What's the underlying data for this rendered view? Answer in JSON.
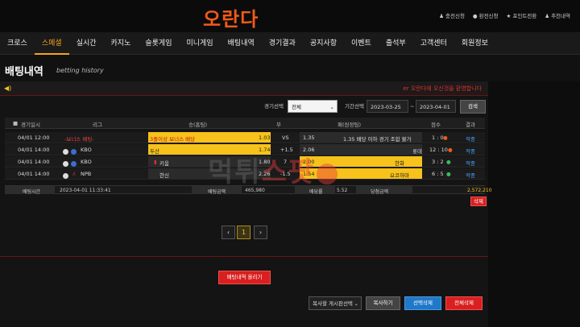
{
  "brand": {
    "logo_text": "오란다"
  },
  "top_links": [
    {
      "icon": "person-plus-icon",
      "label": "충전신청"
    },
    {
      "icon": "coin-icon",
      "label": "환전신청"
    },
    {
      "icon": "star-icon",
      "label": "포인트전환"
    },
    {
      "icon": "users-icon",
      "label": "추천내역"
    }
  ],
  "nav": [
    {
      "label": "크로스"
    },
    {
      "label": "스페셜"
    },
    {
      "label": "실시간"
    },
    {
      "label": "카지노"
    },
    {
      "label": "슬롯게임"
    },
    {
      "label": "미니게임"
    },
    {
      "label": "배팅내역"
    },
    {
      "label": "경기결과"
    },
    {
      "label": "공지사항"
    },
    {
      "label": "이벤트"
    },
    {
      "label": "출석부"
    },
    {
      "label": "고객센터"
    },
    {
      "label": "회원정보"
    }
  ],
  "page": {
    "title": "배팅내역",
    "subtitle": "betting history"
  },
  "notice": {
    "text": "오란다에 오신것을 환영합니다",
    "prefix": "er"
  },
  "filter": {
    "game_label": "경기선택",
    "game_value": "전체",
    "period_label": "기간선택",
    "date_from": "2023-03-25",
    "date_sep": "~",
    "date_to": "2023-04-01",
    "search_button": "검색"
  },
  "table": {
    "headers": [
      "경기일시",
      "리그",
      "승(홈팀)",
      "무",
      "패(원정팀)",
      "점수",
      "결과"
    ],
    "rows": [
      {
        "time": "04/01 12:00",
        "league": "-보너스 배팅-",
        "home": "3폴이상 보너스 배당",
        "home_odds": "1.03",
        "draw": "VS",
        "away_odds": "1.35",
        "away": "1.35 배당 이하 경기 조합 불가",
        "score": "1 : 0",
        "result": "적중"
      },
      {
        "time": "04/01 14:00",
        "league": "KBO",
        "home": "두산",
        "home_odds": "1.74",
        "draw": "+1.5",
        "away_odds": "2.06",
        "away": "롯데",
        "score": "12 : 10",
        "result": "적중"
      },
      {
        "time": "04/01 14:00",
        "league": "KBO",
        "home": "키움",
        "home_odds": "1.80",
        "draw": "7",
        "away_odds": "2.00",
        "away": "한화",
        "score": "3 : 2",
        "result": "적중"
      },
      {
        "time": "04/01 14:00",
        "league": "NPB",
        "home": "한신",
        "home_odds": "2.26",
        "draw": "-1.5",
        "away_odds": "1.54",
        "away": "요코하마",
        "score": "6 : 5",
        "result": "적중"
      }
    ]
  },
  "summary": {
    "bet_time_label": "배팅시간",
    "bet_time": "2023-04-01 11:33:41",
    "bet_amount_label": "배팅금액",
    "bet_amount": "465,980",
    "odds_label": "배당률",
    "odds": "5.52",
    "win_amount_label": "당첨금액",
    "win_amount": "2,572,210"
  },
  "delete_button": "삭제",
  "pagination": {
    "prev": "‹",
    "current": "1",
    "next": "›"
  },
  "actions": {
    "close_history": "배팅내역 올리기",
    "board_select": "복사할 게시판선택",
    "copy": "복사하기",
    "delete_selected": "선택삭제",
    "delete_all": "전체삭제"
  },
  "watermark": {
    "part1": "먹튀",
    "part2": "스팟"
  },
  "colors": {
    "accent": "#f7a41b",
    "highlight": "#f7c21b",
    "danger": "#d91f1f",
    "primary": "#1f78c8",
    "logo": "#f15a1a"
  }
}
